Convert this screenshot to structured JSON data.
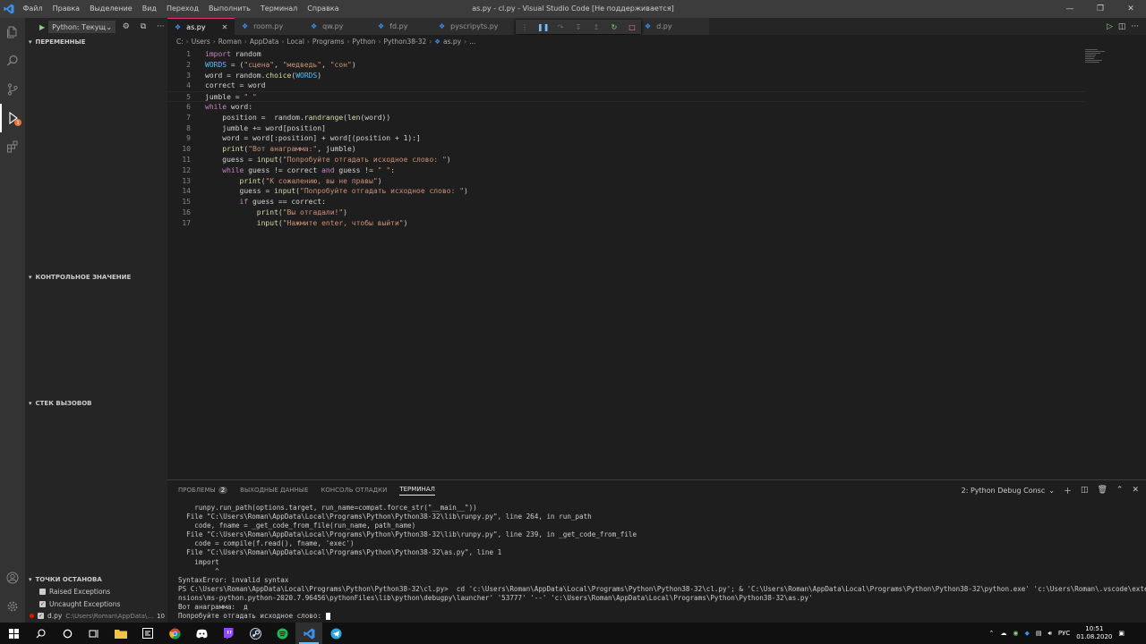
{
  "window": {
    "title": "as.py - cl.py - Visual Studio Code [Не поддерживается]",
    "menu": [
      "Файл",
      "Правка",
      "Выделение",
      "Вид",
      "Переход",
      "Выполнить",
      "Терминал",
      "Справка"
    ]
  },
  "activity_bar": {
    "debug_badge": "1"
  },
  "debug_sidebar": {
    "config_name": "Python: Текущ",
    "sections": {
      "variables": "ПЕРЕМЕННЫЕ",
      "watch": "КОНТРОЛЬНОЕ ЗНАЧЕНИЕ",
      "call_stack": "СТЕК ВЫЗОВОВ",
      "breakpoints": "ТОЧКИ ОСТАНОВА"
    },
    "breakpoints": [
      {
        "label": "Raised Exceptions",
        "checked": false
      },
      {
        "label": "Uncaught Exceptions",
        "checked": true
      },
      {
        "label": "d.py",
        "path": "C:\\Users\\Roman\\AppData\\...",
        "line": "10",
        "checked": true
      }
    ]
  },
  "tabs": [
    {
      "label": "as.py",
      "active": true
    },
    {
      "label": "room.py",
      "active": false
    },
    {
      "label": "qw.py",
      "active": false
    },
    {
      "label": "fd.py",
      "active": false
    },
    {
      "label": "pyscripyts.py",
      "active": false
    },
    {
      "label": "d.py",
      "active": false
    }
  ],
  "breadcrumb": [
    "C:",
    "Users",
    "Roman",
    "AppData",
    "Local",
    "Programs",
    "Python",
    "Python38-32",
    "as.py",
    "..."
  ],
  "editor": {
    "current_line": 5,
    "lines": [
      "import random",
      "WORDS = (\"сцена\", \"медведь\", \"сон\")",
      "word = random.choice(WORDS)",
      "correct = word",
      "jumble = \" \"",
      "while word:",
      "    position =  random.randrange(len(word))",
      "    jumble += word[position]",
      "    word = word[:position] + word[(position + 1):]",
      "    print(\"Вот анаграмма:\", jumble)",
      "    guess = input(\"Попробуйте отгадать исходное слово: \")",
      "    while guess != correct and guess != \" \":",
      "        print(\"К сожалению, вы не правы\")",
      "        guess = input(\"Попробуйте отгадать исходное слово: \")",
      "        if guess == correct:",
      "            print(\"Вы отгадали!\")",
      "            input(\"Нажмите enter, чтобы выйти\")"
    ]
  },
  "panel": {
    "tabs": [
      {
        "label": "ПРОБЛЕМЫ",
        "badge": "2"
      },
      {
        "label": "ВЫХОДНЫЕ ДАННЫЕ"
      },
      {
        "label": "КОНСОЛЬ ОТЛАДКИ"
      },
      {
        "label": "ТЕРМИНАЛ",
        "active": true
      }
    ],
    "terminal_selector": "2: Python Debug Consc",
    "terminal_lines": [
      "    runpy.run_path(options.target, run_name=compat.force_str(\"__main__\"))",
      "  File \"C:\\Users\\Roman\\AppData\\Local\\Programs\\Python\\Python38-32\\lib\\runpy.py\", line 264, in run_path",
      "    code, fname = _get_code_from_file(run_name, path_name)",
      "  File \"C:\\Users\\Roman\\AppData\\Local\\Programs\\Python\\Python38-32\\lib\\runpy.py\", line 239, in _get_code_from_file",
      "    code = compile(f.read(), fname, 'exec')",
      "  File \"C:\\Users\\Roman\\AppData\\Local\\Programs\\Python\\Python38-32\\as.py\", line 1",
      "    import",
      "         ^",
      "SyntaxError: invalid syntax",
      "PS C:\\Users\\Roman\\AppData\\Local\\Programs\\Python\\Python38-32\\cl.py>  cd 'c:\\Users\\Roman\\AppData\\Local\\Programs\\Python\\Python38-32\\cl.py'; & 'C:\\Users\\Roman\\AppData\\Local\\Programs\\Python\\Python38-32\\python.exe' 'c:\\Users\\Roman\\.vscode\\exte",
      "nsions\\ms-python.python-2020.7.96456\\pythonFiles\\lib\\python\\debugpy\\launcher' '53777' '--' 'c:\\Users\\Roman\\AppData\\Local\\Programs\\Python\\Python38-32\\as.py'",
      "Вот анаграмма:  д",
      "Попробуйте отгадать исходное слово: "
    ]
  },
  "taskbar": {
    "language": "РУС",
    "time": "10:51",
    "date": "01.08.2020"
  },
  "colors": {
    "keyword": "#c586c0",
    "string": "#ce9178",
    "function": "#dcdcaa",
    "variable": "#d4d4d4",
    "active_tab_border": "#e03080",
    "accent_blue": "#007acc"
  }
}
